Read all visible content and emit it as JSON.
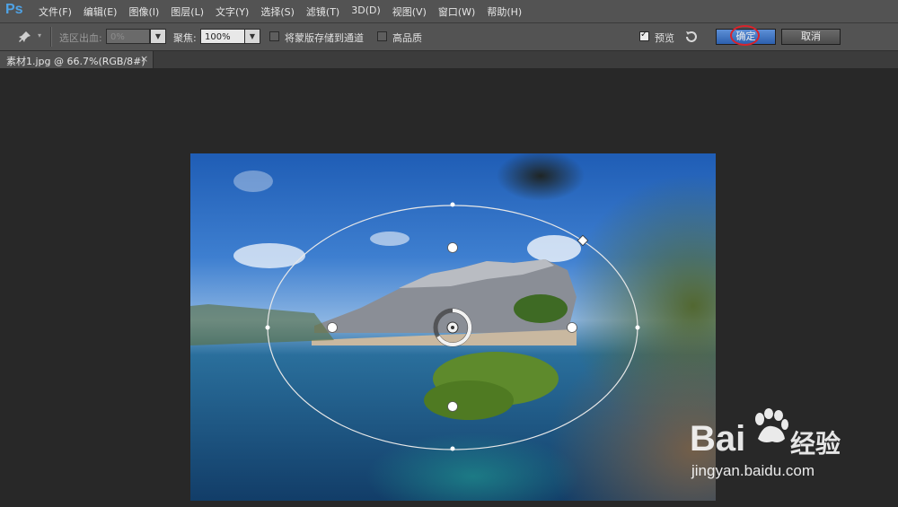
{
  "app": {
    "logo": "Ps"
  },
  "menu": [
    "文件(F)",
    "编辑(E)",
    "图像(I)",
    "图层(L)",
    "文字(Y)",
    "选择(S)",
    "滤镜(T)",
    "3D(D)",
    "视图(V)",
    "窗口(W)",
    "帮助(H)"
  ],
  "options": {
    "selection_bleed_label": "选区出血:",
    "selection_bleed_value": "0%",
    "focus_label": "聚焦:",
    "focus_value": "100%",
    "save_mask_label": "将蒙版存储到通道",
    "save_mask_checked": false,
    "high_quality_label": "高品质",
    "high_quality_checked": false,
    "preview_label": "预览",
    "preview_checked": true,
    "ok_label": "确定",
    "cancel_label": "取消"
  },
  "document_tab": {
    "title": "素材1.jpg @ 66.7%(RGB/8#)",
    "close": "×"
  },
  "watermark": {
    "brand": "Bai",
    "brand_suffix": "经验",
    "url": "jingyan.baidu.com"
  },
  "colors": {
    "accent": "#2c5fae",
    "highlight_circle": "#d9232b"
  }
}
